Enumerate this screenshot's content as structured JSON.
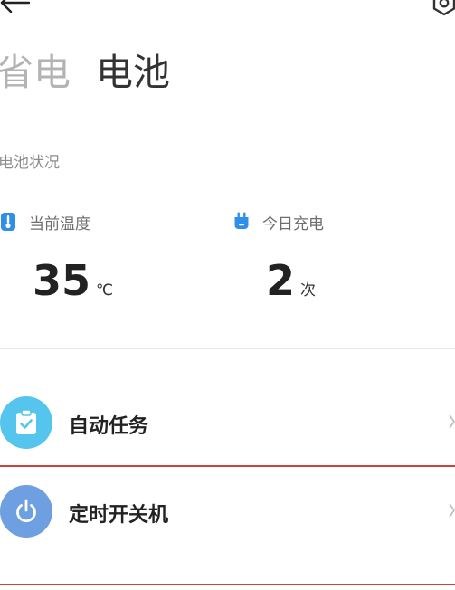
{
  "header": {
    "back_icon": "arrow-left-icon",
    "settings_icon": "gear-icon"
  },
  "tabs": [
    {
      "label": "省电",
      "active": false
    },
    {
      "label": "电池",
      "active": true
    }
  ],
  "battery_status": {
    "section_title": "电池状况",
    "temperature": {
      "icon": "thermometer-icon",
      "label": "当前温度",
      "value": "35",
      "unit": "℃",
      "color": "#2f8fe8"
    },
    "charges_today": {
      "icon": "plug-icon",
      "label": "今日充电",
      "value": "2",
      "unit": "次",
      "color": "#2f8fe8"
    }
  },
  "menu": [
    {
      "label": "自动任务",
      "icon": "clipboard-check-icon",
      "color": "#56c5ed"
    },
    {
      "label": "定时开关机",
      "icon": "power-icon",
      "color": "#6e9fe0"
    }
  ]
}
